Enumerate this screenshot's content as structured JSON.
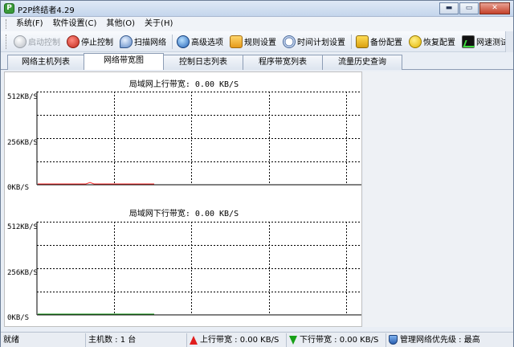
{
  "window": {
    "title": "P2P终结者4.29",
    "buttons": {
      "minimize": "▬",
      "maximize": "▭",
      "close": "✕"
    }
  },
  "menu": [
    "系统(F)",
    "软件设置(C)",
    "其他(O)",
    "关于(H)"
  ],
  "toolbar": {
    "start": "启动控制",
    "stop": "停止控制",
    "scan": "扫描网络",
    "advanced": "高级选项",
    "rules": "规则设置",
    "schedule": "时间计划设置",
    "backup": "备份配置",
    "restore": "恢复配置",
    "speedtest": "网速测试"
  },
  "tabs": [
    "网络主机列表",
    "网络带宽图",
    "控制日志列表",
    "程序带宽列表",
    "流量历史查询"
  ],
  "active_tab_index": 1,
  "charts": {
    "upload": {
      "title": "局域网上行带宽: 0.00 KB/S",
      "ticks": [
        "512KB/S",
        "256KB/S",
        "0KB/S"
      ],
      "line_color": "#ff3030",
      "values": [
        0,
        0,
        0,
        0,
        0,
        0,
        0,
        0,
        0,
        0,
        0,
        0,
        0,
        0.01,
        0,
        0,
        0,
        0,
        0,
        0,
        0,
        0,
        0,
        0,
        0,
        0,
        0,
        0,
        0,
        0
      ]
    },
    "download": {
      "title": "局域网下行带宽: 0.00 KB/S",
      "ticks": [
        "512KB/S",
        "256KB/S",
        "0KB/S"
      ],
      "line_color": "#20a020",
      "values": [
        0,
        0,
        0,
        0,
        0,
        0,
        0,
        0,
        0,
        0,
        0,
        0,
        0,
        0,
        0,
        0,
        0,
        0,
        0,
        0,
        0,
        0,
        0,
        0,
        0,
        0,
        0,
        0,
        0,
        0
      ]
    },
    "ymax": 512
  },
  "status": {
    "ready": "就绪",
    "hosts": "主机数 : 1 台",
    "upload": "上行带宽 : 0.00 KB/S",
    "download": "下行带宽 : 0.00 KB/S",
    "priority": "管理网络优先级 : 最高"
  }
}
